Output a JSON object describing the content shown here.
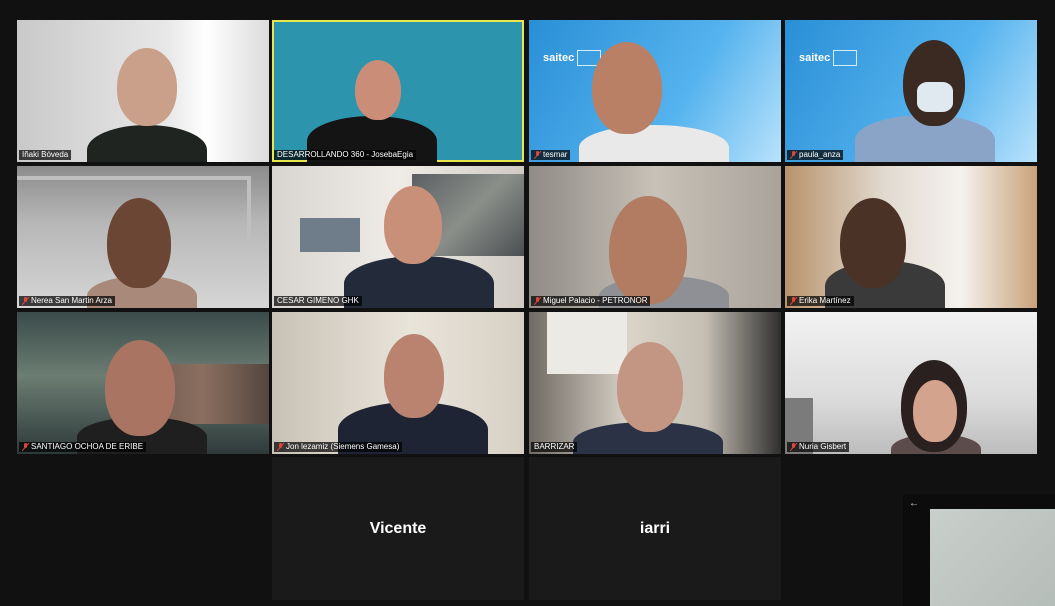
{
  "participants": [
    {
      "name": "Iñaki Bóveda",
      "muted": false
    },
    {
      "name": "DESARROLLANDO 360 - JosebaEgia",
      "muted": false
    },
    {
      "name": "tesmar",
      "muted": true
    },
    {
      "name": "paula_anza",
      "muted": true
    },
    {
      "name": "Nerea San Martin Arza",
      "muted": true
    },
    {
      "name": "CESAR GIMENO GHK",
      "muted": false
    },
    {
      "name": "Miguel Palacio - PETRONOR",
      "muted": true
    },
    {
      "name": "Erika Martínez",
      "muted": true
    },
    {
      "name": "SANTIAGO OCHOA DE ERIBE",
      "muted": true
    },
    {
      "name": "Jon lezamiz (Siemens Gamesa)",
      "muted": true
    },
    {
      "name": "BARRIZAR",
      "muted": false
    },
    {
      "name": "Nuria Gisbert",
      "muted": true
    }
  ],
  "video_off_participants": [
    {
      "name": "Vicente"
    },
    {
      "name": "iarri"
    }
  ],
  "logos": {
    "saitec_1": "saitec",
    "saitec_2": "saitec"
  },
  "icons": {
    "mute": "microphone-muted-icon",
    "collapse": "arrow-left-icon"
  },
  "colors": {
    "active_speaker_border": "#e7e64a",
    "mute_icon": "#e0463c",
    "background": "#111111"
  }
}
